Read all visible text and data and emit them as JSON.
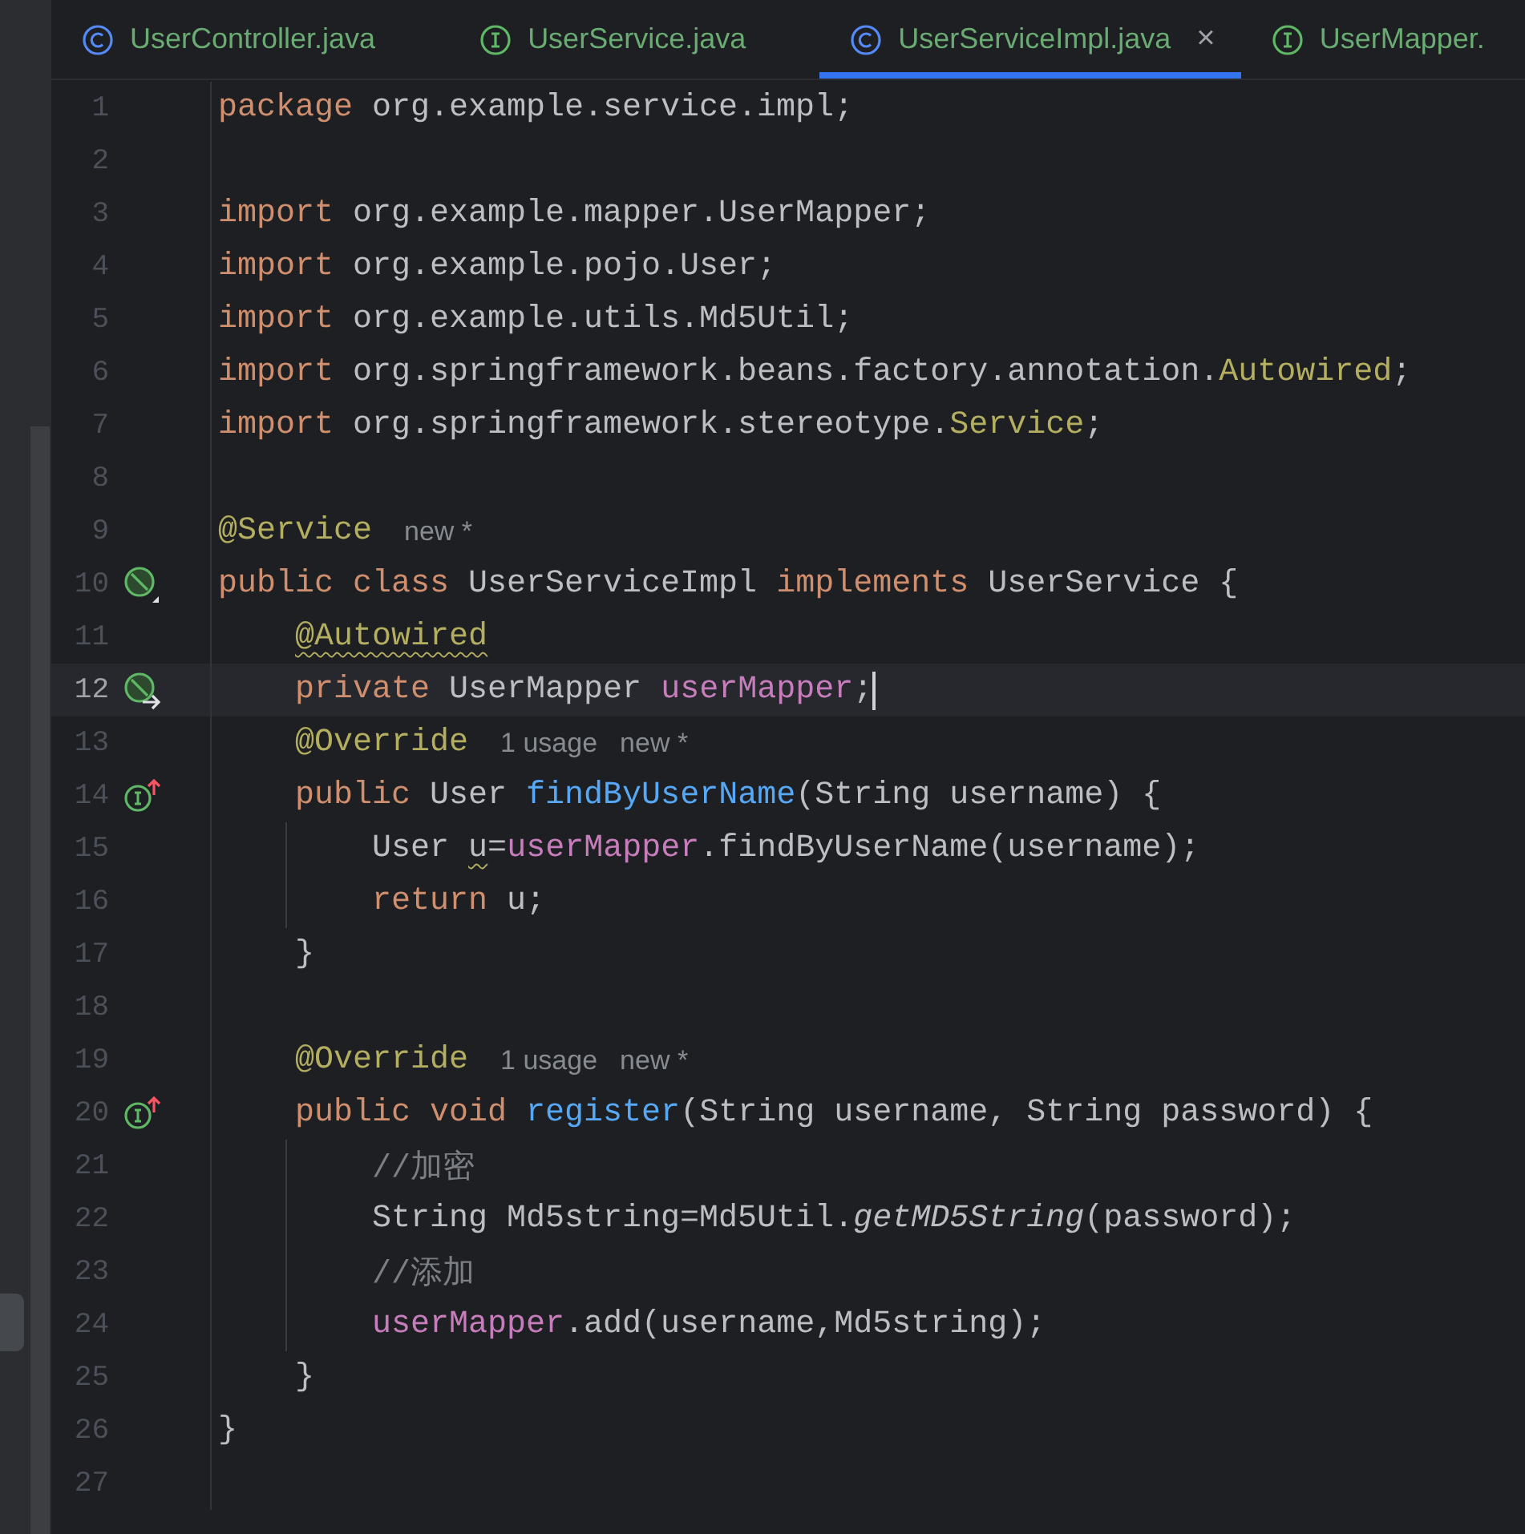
{
  "tabs": [
    {
      "label": "UserController.java",
      "kind": "class",
      "selected": false
    },
    {
      "label": "UserService.java",
      "kind": "interface",
      "selected": false
    },
    {
      "label": "UserServiceImpl.java",
      "kind": "class",
      "selected": true,
      "close": "×"
    },
    {
      "label": "UserMapper.",
      "kind": "interface",
      "selected": false
    }
  ],
  "editor": {
    "lines": [
      {
        "number": "1",
        "current": false,
        "guide": false,
        "tokens": [
          {
            "t": "package ",
            "kind": "kw"
          },
          {
            "t": "org.example.service.impl;",
            "kind": "plain"
          }
        ]
      },
      {
        "number": "2",
        "current": false,
        "guide": false
      },
      {
        "number": "3",
        "current": false,
        "guide": false,
        "tokens": [
          {
            "t": "import ",
            "kind": "kw"
          },
          {
            "t": "org.example.mapper.UserMapper;",
            "kind": "plain"
          }
        ]
      },
      {
        "number": "4",
        "current": false,
        "guide": false,
        "tokens": [
          {
            "t": "import ",
            "kind": "kw"
          },
          {
            "t": "org.example.pojo.User;",
            "kind": "plain"
          }
        ]
      },
      {
        "number": "5",
        "current": false,
        "guide": false,
        "tokens": [
          {
            "t": "import ",
            "kind": "kw"
          },
          {
            "t": "org.example.utils.Md5Util;",
            "kind": "plain"
          }
        ]
      },
      {
        "number": "6",
        "current": false,
        "guide": false,
        "tokens": [
          {
            "t": "import ",
            "kind": "kw"
          },
          {
            "t": "org.springframework.beans.factory.annotation.",
            "kind": "plain"
          },
          {
            "t": "Autowired",
            "kind": "ann"
          },
          {
            "t": ";",
            "kind": "plain"
          }
        ]
      },
      {
        "number": "7",
        "current": false,
        "guide": false,
        "tokens": [
          {
            "t": "import ",
            "kind": "kw"
          },
          {
            "t": "org.springframework.stereotype.",
            "kind": "plain"
          },
          {
            "t": "Service",
            "kind": "ann"
          },
          {
            "t": ";",
            "kind": "plain"
          }
        ]
      },
      {
        "number": "8",
        "current": false,
        "guide": false
      },
      {
        "number": "9",
        "current": false,
        "guide": false,
        "tokens": [
          {
            "t": "@Service",
            "kind": "ann"
          },
          {
            "t": "new *",
            "kind": "hint"
          }
        ]
      },
      {
        "number": "10",
        "current": false,
        "guide": false,
        "kind": "bean",
        "tokens": [
          {
            "t": "public class ",
            "kind": "kw"
          },
          {
            "t": "UserServiceImpl ",
            "kind": "plain"
          },
          {
            "t": "implements ",
            "kind": "kw"
          },
          {
            "t": "UserService {",
            "kind": "plain"
          }
        ]
      },
      {
        "number": "11",
        "current": false,
        "guide": false,
        "tokens": [
          {
            "t": "    @Autowired",
            "kind": "ann",
            "warn": true
          }
        ]
      },
      {
        "number": "12",
        "current": true,
        "guide": false,
        "kind": "injection",
        "tokens": [
          {
            "t": "    private ",
            "kind": "kw"
          },
          {
            "t": "UserMapper ",
            "kind": "plain"
          },
          {
            "t": "userMapper",
            "kind": "field"
          },
          {
            "t": ";",
            "kind": "plain"
          }
        ]
      },
      {
        "number": "13",
        "current": false,
        "guide": false,
        "tokens": [
          {
            "t": "    @Override",
            "kind": "ann"
          },
          {
            "t": "1 usage",
            "kind": "hint"
          },
          {
            "t": "new *",
            "kind": "hint"
          }
        ]
      },
      {
        "number": "14",
        "current": false,
        "guide": false,
        "kind": "implements",
        "tokens": [
          {
            "t": "    public ",
            "kind": "kw"
          },
          {
            "t": "User ",
            "kind": "plain"
          },
          {
            "t": "findByUserName",
            "kind": "method"
          },
          {
            "t": "(String username) {",
            "kind": "plain"
          }
        ]
      },
      {
        "number": "15",
        "current": false,
        "guide": true,
        "tokens": [
          {
            "t": "        User ",
            "kind": "plain"
          },
          {
            "t": "u",
            "kind": "plain",
            "warn": true
          },
          {
            "t": "=",
            "kind": "plain"
          },
          {
            "t": "userMapper",
            "kind": "field"
          },
          {
            "t": ".findByUserName(username);",
            "kind": "plain"
          }
        ]
      },
      {
        "number": "16",
        "current": false,
        "guide": true,
        "tokens": [
          {
            "t": "        return ",
            "kind": "kw"
          },
          {
            "t": "u;",
            "kind": "plain"
          }
        ]
      },
      {
        "number": "17",
        "current": false,
        "guide": false,
        "tokens": [
          {
            "t": "    }",
            "kind": "plain"
          }
        ]
      },
      {
        "number": "18",
        "current": false,
        "guide": false
      },
      {
        "number": "19",
        "current": false,
        "guide": false,
        "tokens": [
          {
            "t": "    @Override",
            "kind": "ann"
          },
          {
            "t": "1 usage",
            "kind": "hint"
          },
          {
            "t": "new *",
            "kind": "hint"
          }
        ]
      },
      {
        "number": "20",
        "current": false,
        "guide": false,
        "kind": "implements",
        "tokens": [
          {
            "t": "    public void ",
            "kind": "kw"
          },
          {
            "t": "register",
            "kind": "method"
          },
          {
            "t": "(String username, String password) {",
            "kind": "plain"
          }
        ]
      },
      {
        "number": "21",
        "current": false,
        "guide": true,
        "tokens": [
          {
            "t": "        //加密",
            "kind": "comment"
          }
        ]
      },
      {
        "number": "22",
        "current": false,
        "guide": true,
        "tokens": [
          {
            "t": "        String Md5string=Md5Util.",
            "kind": "plain"
          },
          {
            "t": "getMD5String",
            "kind": "static"
          },
          {
            "t": "(password);",
            "kind": "plain"
          }
        ]
      },
      {
        "number": "23",
        "current": false,
        "guide": true,
        "tokens": [
          {
            "t": "        //添加",
            "kind": "comment"
          }
        ]
      },
      {
        "number": "24",
        "current": false,
        "guide": true,
        "tokens": [
          {
            "t": "        userMapper",
            "kind": "field"
          },
          {
            "t": ".add(username,Md5string);",
            "kind": "plain"
          }
        ]
      },
      {
        "number": "25",
        "current": false,
        "guide": false,
        "tokens": [
          {
            "t": "    }",
            "kind": "plain"
          }
        ]
      },
      {
        "number": "26",
        "current": false,
        "guide": false,
        "tokens": [
          {
            "t": "}",
            "kind": "plain"
          }
        ]
      },
      {
        "number": "27",
        "current": false,
        "guide": false
      }
    ]
  }
}
